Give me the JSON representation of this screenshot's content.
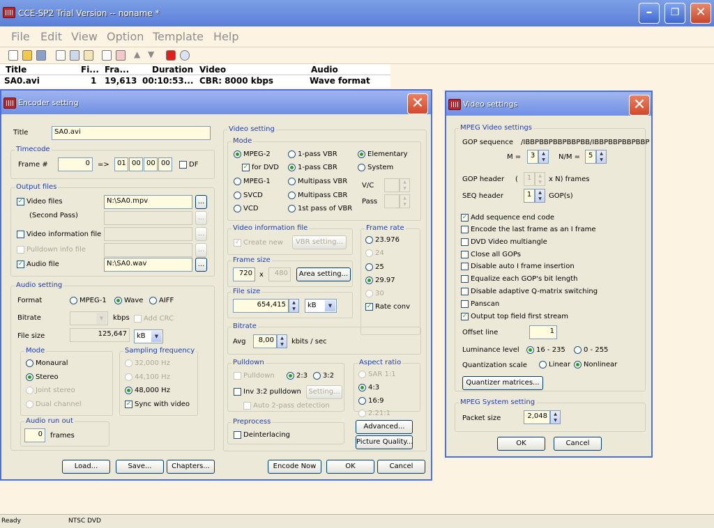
{
  "app": {
    "title": "CCE-SP2 Trial Version -- noname *"
  },
  "menu": [
    "File",
    "Edit",
    "View",
    "Option",
    "Template",
    "Help"
  ],
  "list": {
    "headers": [
      "Title",
      "Fi...",
      "Fra...",
      "Duration",
      "Video",
      "Audio"
    ],
    "row": {
      "title": "SA0.avi",
      "fi": "1",
      "frames": "19,613",
      "duration": "00:10:53...",
      "video": "CBR: 8000 kbps",
      "audio": "Wave format"
    }
  },
  "status": {
    "left": "Ready",
    "right": "NTSC DVD"
  },
  "encoder": {
    "title": "Encoder setting",
    "title_label": "Title",
    "title_value": "SA0.avi",
    "timecode": {
      "label": "Timecode",
      "frame_label": "Frame #",
      "frame_value": "0",
      "arrow": "=>",
      "hh": "01",
      "mm": "00",
      "ss": "00",
      "ff": "00",
      "df": "DF"
    },
    "output": {
      "label": "Output files",
      "video_files": "Video files",
      "video_path": "N:\\SA0.mpv",
      "second_pass": "(Second Pass)",
      "video_info": "Video information file",
      "pulldown_info": "Pulldown info file",
      "audio_file": "Audio file",
      "audio_path": "N:\\SA0.wav",
      "browse": "..."
    },
    "audio": {
      "label": "Audio setting",
      "format": "Format",
      "mpeg1": "MPEG-1",
      "wave": "Wave",
      "aiff": "AIFF",
      "bitrate": "Bitrate",
      "kbps": "kbps",
      "add_crc": "Add CRC",
      "file_size": "File size",
      "file_size_value": "125,647",
      "unit": "kB",
      "mode": {
        "label": "Mode",
        "monaural": "Monaural",
        "stereo": "Stereo",
        "joint": "Joint stereo",
        "dual": "Dual channel"
      },
      "sampling": {
        "label": "Sampling frequency",
        "f32": "32,000 Hz",
        "f44": "44,100 Hz",
        "f48": "48,000 Hz",
        "sync": "Sync with video"
      },
      "runout": {
        "label": "Audio run out",
        "value": "0",
        "frames": "frames"
      }
    },
    "video": {
      "label": "Video setting",
      "mode_label": "Mode",
      "mpeg2": "MPEG-2",
      "for_dvd": "for DVD",
      "mpeg1": "MPEG-1",
      "svcd": "SVCD",
      "vcd": "VCD",
      "vbr1": "1-pass VBR",
      "cbr1": "1-pass CBR",
      "mvbr": "Multipass VBR",
      "mcbr": "Multipass CBR",
      "first_vbr": "1st pass of VBR",
      "elementary": "Elementary",
      "system": "System",
      "vc": "V/C",
      "pass": "Pass",
      "info_label": "Video information file",
      "create_new": "Create new",
      "vbr_setting": "VBR setting...",
      "framerate": {
        "label": "Frame rate",
        "r1": "23.976",
        "r2": "24",
        "r3": "25",
        "r4": "29.97",
        "r5": "30",
        "rate_conv": "Rate conv"
      },
      "framesize": {
        "label": "Frame size",
        "w": "720",
        "x": "x",
        "h": "480",
        "area": "Area setting..."
      },
      "filesize": {
        "label": "File size",
        "value": "654,415",
        "unit": "kB"
      },
      "bitrate": {
        "label": "Bitrate",
        "avg": "Avg",
        "value": "8,00",
        "unit": "kbits / sec"
      },
      "pulldown": {
        "label": "Pulldown",
        "pulldown": "Pulldown",
        "r23": "2:3",
        "r32": "3:2",
        "inv": "Inv 3:2 pulldown",
        "setting": "Setting...",
        "auto2": "Auto 2-pass detection"
      },
      "aspect": {
        "label": "Aspect ratio",
        "sar": "SAR 1:1",
        "a43": "4:3",
        "a169": "16:9",
        "a221": "2.21:1"
      },
      "preprocess": {
        "label": "Preprocess",
        "deinterlacing": "Deinterlacing"
      },
      "advanced": "Advanced...",
      "picture": "Picture Quality..."
    },
    "buttons": {
      "load": "Load...",
      "save": "Save...",
      "chapters": "Chapters...",
      "encode": "Encode Now",
      "ok": "OK",
      "cancel": "Cancel"
    }
  },
  "vset": {
    "title": "Video settings",
    "mpeg_label": "MPEG Video settings",
    "gop_seq": "GOP sequence",
    "gop_value": "/IBBPBBPBBPBBPBB/IBBPBBPBBPBBP",
    "m_label": "M =",
    "m_value": "3",
    "nm_label": "N/M =",
    "nm_value": "5",
    "gop_header": "GOP header",
    "paren": "(",
    "gh_value": "1",
    "gh_suffix": "x N) frames",
    "seq_header": "SEQ header",
    "seq_value": "1",
    "seq_suffix": "GOP(s)",
    "checks": [
      {
        "label": "Add sequence end code",
        "checked": true
      },
      {
        "label": "Encode the last frame as an I frame",
        "checked": false
      },
      {
        "label": "DVD Video multiangle",
        "checked": false
      },
      {
        "label": "Close all GOPs",
        "checked": false
      },
      {
        "label": "Disable auto I frame insertion",
        "checked": false
      },
      {
        "label": "Equalize each GOP's bit length",
        "checked": false
      },
      {
        "label": "Disable adaptive Q-matrix switching",
        "checked": false
      },
      {
        "label": "Panscan",
        "checked": false
      },
      {
        "label": "Output top field first stream",
        "checked": true
      }
    ],
    "offset_line": "Offset line",
    "offset_value": "1",
    "luminance": "Luminance level",
    "lum1": "16 - 235",
    "lum2": "0 - 255",
    "quant": "Quantization scale",
    "linear": "Linear",
    "nonlinear": "Nonlinear",
    "quant_btn": "Quantizer matrices...",
    "sys_label": "MPEG System setting",
    "packet": "Packet size",
    "packet_value": "2,048",
    "ok": "OK",
    "cancel": "Cancel"
  }
}
